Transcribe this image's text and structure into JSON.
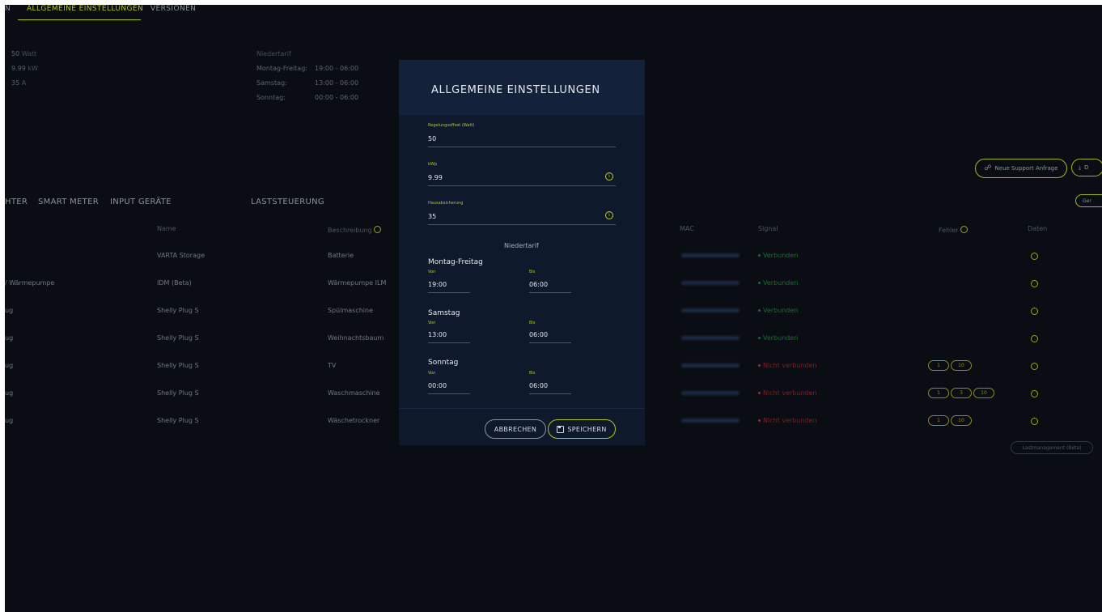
{
  "top_tabs": [
    "N",
    "ALLGEMEINE EINSTELLUNGEN",
    "VERSIONEN"
  ],
  "summary": {
    "rows": [
      {
        "value": "50",
        "unit": "Watt"
      },
      {
        "value": "9.99",
        "unit": "kW"
      },
      {
        "value": "35",
        "unit": "A"
      }
    ]
  },
  "tarif": {
    "title": "Niedertarif",
    "rows": [
      {
        "label": "Montag-Freitag:",
        "value": "19:00 - 06:00"
      },
      {
        "label": "Samstag:",
        "value": "13:00 - 06:00"
      },
      {
        "label": "Sonntag:",
        "value": "00:00 - 06:00"
      }
    ]
  },
  "actions": {
    "support": "Neue Support Anfrage",
    "download": "D",
    "ger": "Ger"
  },
  "sub_tabs": [
    "HTER",
    "SMART METER",
    "INPUT GERÄTE",
    "LASTSTEUERUNG"
  ],
  "table": {
    "headers": {
      "name": "Name",
      "desc": "Beschreibung",
      "mac": "MAC",
      "signal": "Signal",
      "fehler": "Fehler",
      "daten": "Daten"
    },
    "rows": [
      {
        "type": "",
        "name": "VARTA Storage",
        "desc": "Batterie",
        "signal": "Verbunden",
        "ok": true,
        "errors": []
      },
      {
        "type": "/ Wärmepumpe",
        "name": "IDM (Beta)",
        "desc": "Wärmepumpe ILM",
        "signal": "Verbunden",
        "ok": true,
        "errors": []
      },
      {
        "type": "ug",
        "name": "Shelly Plug S",
        "desc": "Spülmaschine",
        "signal": "Verbunden",
        "ok": true,
        "errors": []
      },
      {
        "type": "ug",
        "name": "Shelly Plug S",
        "desc": "Weihnachtsbaum",
        "signal": "Verbunden",
        "ok": true,
        "errors": []
      },
      {
        "type": "ug",
        "name": "Shelly Plug S",
        "desc": "TV",
        "signal": "Nicht verbunden",
        "ok": false,
        "errors": [
          "1",
          "10"
        ]
      },
      {
        "type": "ug",
        "name": "Shelly Plug S",
        "desc": "Waschmaschine",
        "signal": "Nicht verbunden",
        "ok": false,
        "errors": [
          "1",
          "3",
          "10"
        ]
      },
      {
        "type": "ug",
        "name": "Shelly Plug S",
        "desc": "Wäschetrockner",
        "signal": "Nicht verbunden",
        "ok": false,
        "errors": [
          "1",
          "10"
        ]
      }
    ],
    "footer_button": "Lastmanagement (Beta)"
  },
  "modal": {
    "title": "ALLGEMEINE EINSTELLUNGEN",
    "fields": [
      {
        "label": "Regelungsoffset (Watt)",
        "value": "50",
        "icon": false
      },
      {
        "label": "kWp",
        "value": "9.99",
        "icon": true
      },
      {
        "label": "Hausabsicherung",
        "value": "35",
        "icon": true
      }
    ],
    "section": "Niedertarif",
    "von_label": "Von",
    "bis_label": "Bis",
    "days": [
      {
        "name": "Montag-Freitag",
        "von": "19:00",
        "bis": "06:00"
      },
      {
        "name": "Samstag",
        "von": "13:00",
        "bis": "06:00"
      },
      {
        "name": "Sonntag",
        "von": "00:00",
        "bis": "06:00"
      }
    ],
    "cancel": "ABBRECHEN",
    "save": "SPEICHERN"
  },
  "colors": {
    "accent": "#b7c21e",
    "background": "#0a0e14",
    "modal": "#0e1a2b",
    "ok": "#1c6b34",
    "error": "#7a2020"
  }
}
